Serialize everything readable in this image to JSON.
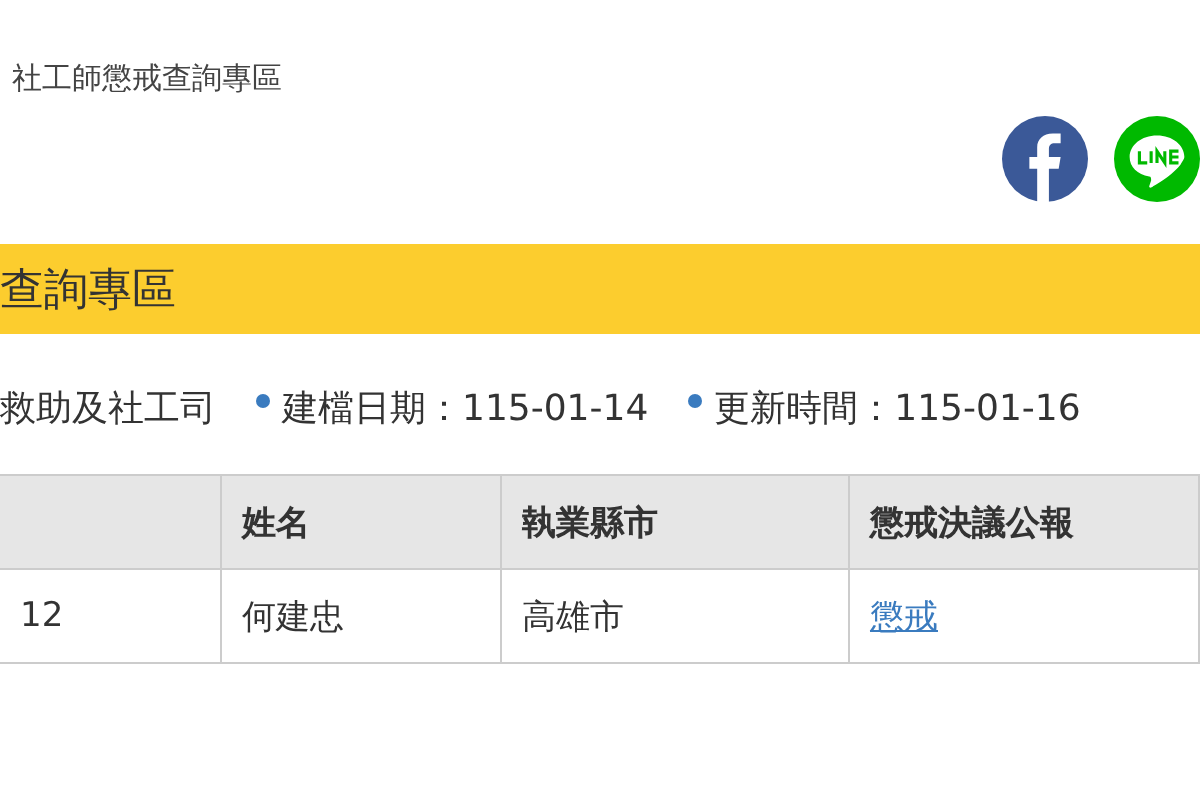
{
  "breadcrumb": "社工師懲戒查詢專區",
  "share": [
    {
      "kind": "facebook"
    },
    {
      "kind": "line"
    }
  ],
  "page_title": "查詢專區",
  "meta": [
    {
      "text": "救助及社工司",
      "bullet": false
    },
    {
      "text": "建檔日期：115-01-14",
      "bullet": true
    },
    {
      "text": "更新時間：115-01-16",
      "bullet": true
    }
  ],
  "table": {
    "columns": [
      "",
      "姓名",
      "執業縣市",
      "懲戒決議公報"
    ],
    "rows": [
      [
        {
          "text": "12"
        },
        {
          "text": "何建忠"
        },
        {
          "text": "高雄市"
        },
        {
          "text": "懲戒",
          "link": true
        }
      ]
    ]
  }
}
